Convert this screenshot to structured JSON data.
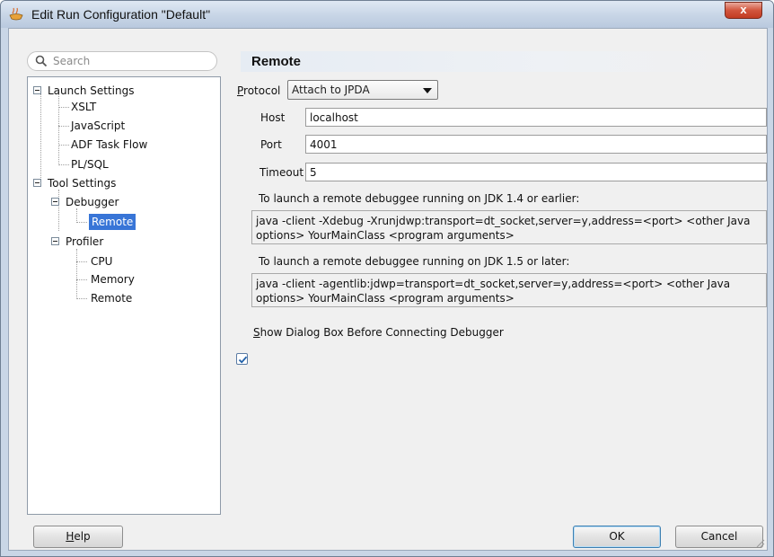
{
  "window": {
    "title": "Edit Run Configuration \"Default\"",
    "close_glyph": "x",
    "icon": "coffee-cup-icon"
  },
  "search": {
    "placeholder": "Search"
  },
  "tree": {
    "launch_settings": "Launch Settings",
    "xslt": "XSLT",
    "javascript": "JavaScript",
    "adf_task_flow": "ADF Task Flow",
    "plsql": "PL/SQL",
    "tool_settings": "Tool Settings",
    "debugger": "Debugger",
    "debugger_remote": "Remote",
    "profiler": "Profiler",
    "cpu": "CPU",
    "memory": "Memory",
    "profiler_remote": "Remote"
  },
  "panel": {
    "title": "Remote",
    "protocol_label": "Protocol",
    "protocol_value": "Attach to JPDA",
    "host_label": "Host",
    "host_value": "localhost",
    "port_label": "Port",
    "port_value": "4001",
    "timeout_label": "Timeout",
    "timeout_value": "5",
    "jdk14_label": "To launch a remote debuggee running on JDK 1.4 or earlier:",
    "jdk14_cmd": "java -client -Xdebug -Xrunjdwp:transport=dt_socket,server=y,address=<port> <other Java options> YourMainClass <program arguments>",
    "jdk15_label": "To launch a remote debuggee running on JDK 1.5 or later:",
    "jdk15_cmd": "java -client -agentlib:jdwp=transport=dt_socket,server=y,address=<port> <other Java options> YourMainClass <program arguments>",
    "show_dialog_label": "Show Dialog Box Before Connecting Debugger",
    "show_dialog_checked": true
  },
  "buttons": {
    "help": "Help",
    "ok": "OK",
    "cancel": "Cancel"
  },
  "colors": {
    "selection": "#3875d7",
    "accent_close": "#c23b22"
  }
}
